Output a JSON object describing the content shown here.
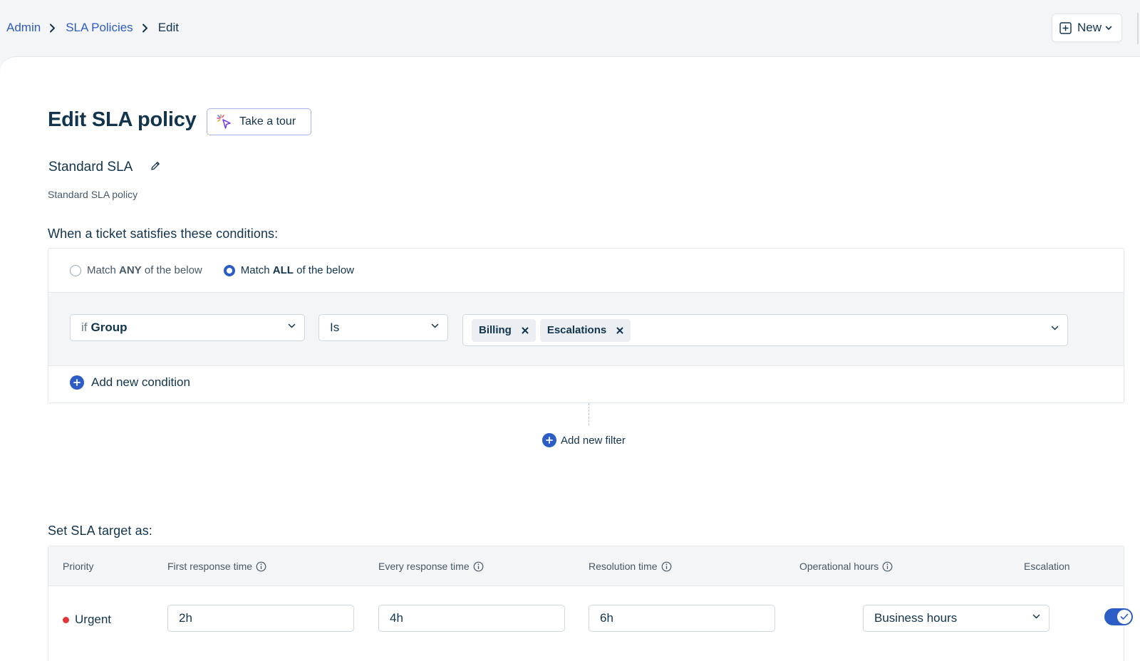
{
  "breadcrumb": {
    "items": [
      "Admin",
      "SLA Policies"
    ],
    "current": "Edit"
  },
  "header": {
    "new_button_label": "New"
  },
  "page": {
    "title": "Edit SLA policy",
    "tour_button_label": "Take a tour",
    "policy_name": "Standard SLA",
    "policy_description": "Standard SLA policy"
  },
  "conditions": {
    "heading": "When a ticket satisfies these conditions:",
    "match_any": {
      "prefix": "Match ",
      "keyword": "ANY",
      "suffix": " of the below",
      "selected": false
    },
    "match_all": {
      "prefix": "Match ",
      "keyword": "ALL",
      "suffix": " of the below",
      "selected": true
    },
    "rule": {
      "field_prefix": "if",
      "field": "Group",
      "operator": "Is",
      "values": [
        "Billing",
        "Escalations"
      ]
    },
    "add_condition_label": "Add new condition",
    "add_filter_label": "Add new filter"
  },
  "sla_target": {
    "heading": "Set SLA target as:",
    "columns": [
      "Priority",
      "First response time",
      "Every response time",
      "Resolution time",
      "Operational hours",
      "Escalation"
    ],
    "rows": [
      {
        "priority": "Urgent",
        "priority_color": "#e43538",
        "first_response": "2h",
        "every_response": "4h",
        "resolution": "6h",
        "operational_hours": "Business hours",
        "escalation": true
      }
    ]
  },
  "colors": {
    "accent": "#2c5cc5",
    "text": "#12344d",
    "background": "#f4f5f7"
  }
}
